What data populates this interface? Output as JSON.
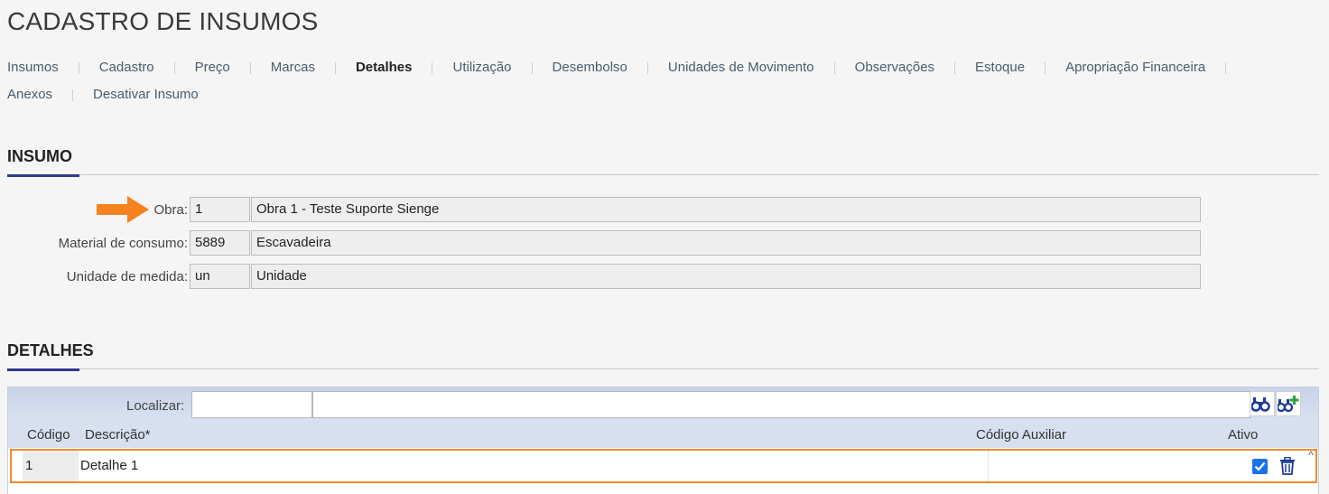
{
  "page": {
    "title": "CADASTRO DE INSUMOS"
  },
  "tabs": {
    "row1": [
      "Insumos",
      "Cadastro",
      "Preço",
      "Marcas",
      "Detalhes",
      "Utilização",
      "Desembolso",
      "Unidades de Movimento",
      "Observações",
      "Estoque",
      "Apropriação Financeira"
    ],
    "row2": [
      "Anexos",
      "Desativar Insumo"
    ],
    "active": "Detalhes"
  },
  "insumo": {
    "title": "INSUMO",
    "fields": [
      {
        "label": "Obra:",
        "code": "1",
        "value": "Obra 1 - Teste Suporte Sienge"
      },
      {
        "label": "Material de consumo:",
        "code": "5889",
        "value": "Escavadeira"
      },
      {
        "label": "Unidade de medida:",
        "code": "un",
        "value": "Unidade"
      }
    ]
  },
  "detalhes": {
    "title": "DETALHES",
    "search_label": "Localizar:",
    "search_value": "",
    "search_value_2": "",
    "columns": {
      "codigo": "Código",
      "descricao": "Descrição*",
      "codigo_auxiliar": "Código Auxiliar",
      "ativo": "Ativo"
    },
    "rows": [
      {
        "codigo": "1",
        "descricao": "Detalhe 1",
        "codigo_auxiliar": "",
        "ativo": true
      }
    ]
  },
  "icons": {
    "search": "binoculars-icon",
    "add": "binoculars-add-icon",
    "delete": "trash-icon",
    "pointer": "arrow-right-icon"
  },
  "colors": {
    "accent": "#2d3a8c",
    "highlight": "#f08a2c",
    "arrow": "#f58220",
    "checkbox": "#1a73e8"
  }
}
